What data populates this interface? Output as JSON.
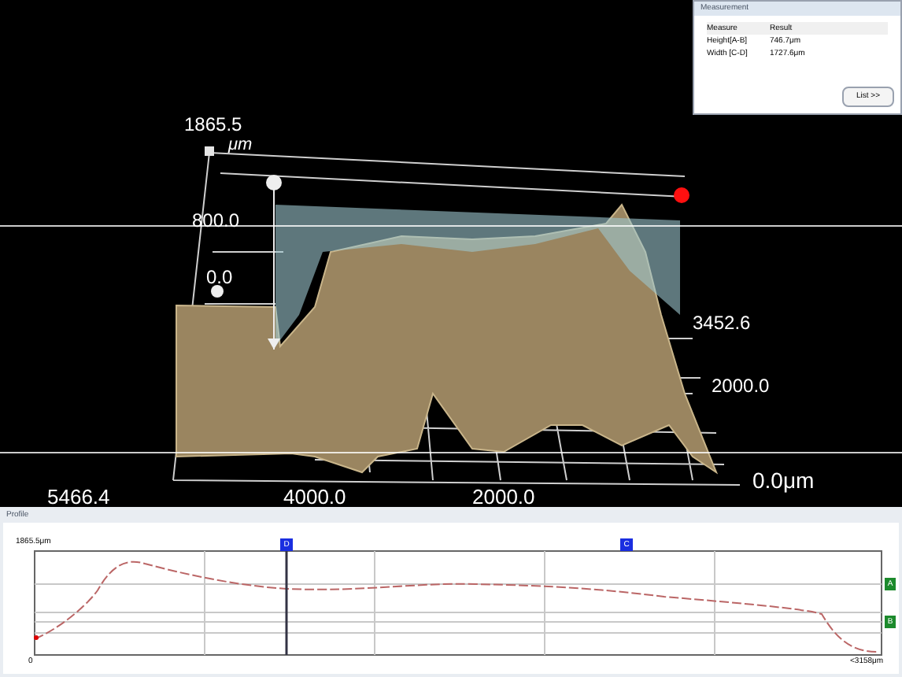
{
  "view3d": {
    "z_max": "1865.5",
    "z_unit": "μm",
    "z_ticks": [
      "800.0",
      "0.0"
    ],
    "y_ticks": [
      "3452.6",
      "2000.0",
      "0.0μm"
    ],
    "x_ticks": [
      "5466.4",
      "4000.0",
      "2000.0"
    ]
  },
  "measurement": {
    "title": "Measurement",
    "columns": [
      "Measure",
      "Result"
    ],
    "rows": [
      {
        "measure": "Height[A-B]",
        "result": "746.7μm"
      },
      {
        "measure": "Width [C-D]",
        "result": "1727.6μm"
      }
    ],
    "button": "List >>"
  },
  "profile": {
    "title": "Profile",
    "y_max": "1865.5μm",
    "y_min": "0",
    "x_max": "<3158μm",
    "top_markers": [
      "D",
      "C"
    ],
    "side_markers": [
      "A",
      "B"
    ]
  }
}
